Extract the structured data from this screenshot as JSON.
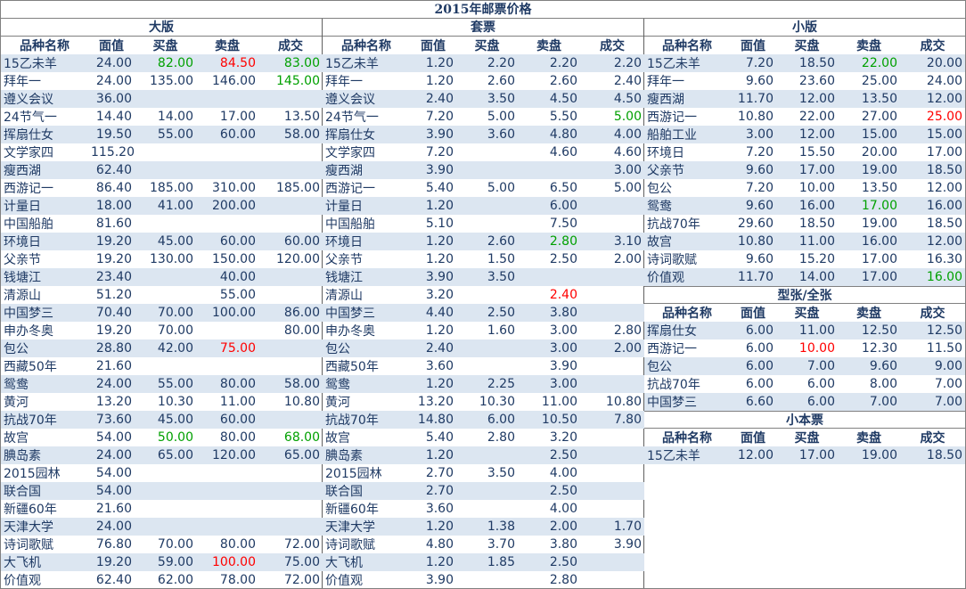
{
  "title": "2015年邮票价格",
  "headers": [
    "品种名称",
    "面值",
    "买盘",
    "卖盘",
    "成交"
  ],
  "colors": {
    "up": "#00a000",
    "down": "#ff0000",
    "stripe": "#dce6f1",
    "text": "#1f3a64"
  },
  "left": {
    "title": "大版",
    "rows": [
      {
        "name": "15乙未羊",
        "face": "24.00",
        "bid": "82.00",
        "ask": "84.50",
        "deal": "83.00",
        "bc": "green",
        "ac": "red",
        "dc": "green"
      },
      {
        "name": "拜年一",
        "face": "24.00",
        "bid": "135.00",
        "ask": "146.00",
        "deal": "145.00",
        "dc": "green"
      },
      {
        "name": "遵义会议",
        "face": "36.00",
        "bid": "",
        "ask": "",
        "deal": ""
      },
      {
        "name": "24节气一",
        "face": "14.40",
        "bid": "14.00",
        "ask": "17.00",
        "deal": "13.50"
      },
      {
        "name": "挥扇仕女",
        "face": "19.50",
        "bid": "55.00",
        "ask": "60.00",
        "deal": "58.00"
      },
      {
        "name": "文学家四",
        "face": "115.20",
        "bid": "",
        "ask": "",
        "deal": ""
      },
      {
        "name": "瘦西湖",
        "face": "62.40",
        "bid": "",
        "ask": "",
        "deal": ""
      },
      {
        "name": "西游记一",
        "face": "86.40",
        "bid": "185.00",
        "ask": "310.00",
        "deal": "185.00"
      },
      {
        "name": "计量日",
        "face": "18.00",
        "bid": "41.00",
        "ask": "200.00",
        "deal": ""
      },
      {
        "name": "中国船舶",
        "face": "81.60",
        "bid": "",
        "ask": "",
        "deal": ""
      },
      {
        "name": "环境日",
        "face": "19.20",
        "bid": "45.00",
        "ask": "60.00",
        "deal": "60.00"
      },
      {
        "name": "父亲节",
        "face": "19.20",
        "bid": "130.00",
        "ask": "150.00",
        "deal": "120.00"
      },
      {
        "name": "钱塘江",
        "face": "23.40",
        "bid": "",
        "ask": "40.00",
        "deal": ""
      },
      {
        "name": "清源山",
        "face": "51.20",
        "bid": "",
        "ask": "55.00",
        "deal": ""
      },
      {
        "name": "中国梦三",
        "face": "70.40",
        "bid": "70.00",
        "ask": "100.00",
        "deal": "86.00"
      },
      {
        "name": "申办冬奥",
        "face": "19.20",
        "bid": "70.00",
        "ask": "",
        "deal": "80.00"
      },
      {
        "name": "包公",
        "face": "28.80",
        "bid": "42.00",
        "ask": "75.00",
        "deal": "",
        "ac": "red"
      },
      {
        "name": "西藏50年",
        "face": "21.60",
        "bid": "",
        "ask": "",
        "deal": ""
      },
      {
        "name": "鸳鸯",
        "face": "24.00",
        "bid": "55.00",
        "ask": "80.00",
        "deal": "58.00"
      },
      {
        "name": "黄河",
        "face": "13.20",
        "bid": "10.30",
        "ask": "11.00",
        "deal": "10.80"
      },
      {
        "name": "抗战70年",
        "face": "73.60",
        "bid": "45.00",
        "ask": "60.00",
        "deal": ""
      },
      {
        "name": "故宫",
        "face": "54.00",
        "bid": "50.00",
        "ask": "80.00",
        "deal": "68.00",
        "bc": "green",
        "dc": "green"
      },
      {
        "name": "腆岛素",
        "face": "24.00",
        "bid": "65.00",
        "ask": "120.00",
        "deal": "65.00"
      },
      {
        "name": "2015园林",
        "face": "54.00",
        "bid": "",
        "ask": "",
        "deal": ""
      },
      {
        "name": "联合国",
        "face": "54.00",
        "bid": "",
        "ask": "",
        "deal": ""
      },
      {
        "name": "新疆60年",
        "face": "21.60",
        "bid": "",
        "ask": "",
        "deal": ""
      },
      {
        "name": "天津大学",
        "face": "24.00",
        "bid": "",
        "ask": "",
        "deal": ""
      },
      {
        "name": "诗词歌赋",
        "face": "76.80",
        "bid": "70.00",
        "ask": "80.00",
        "deal": "72.00"
      },
      {
        "name": "大飞机",
        "face": "19.20",
        "bid": "59.00",
        "ask": "100.00",
        "deal": "75.00",
        "ac": "red"
      },
      {
        "name": "价值观",
        "face": "62.40",
        "bid": "62.00",
        "ask": "78.00",
        "deal": "72.00"
      }
    ]
  },
  "mid": {
    "title": "套票",
    "rows": [
      {
        "name": "15乙未羊",
        "face": "1.20",
        "bid": "2.20",
        "ask": "2.20",
        "deal": "2.20"
      },
      {
        "name": "拜年一",
        "face": "1.20",
        "bid": "2.60",
        "ask": "2.60",
        "deal": "2.40"
      },
      {
        "name": "遵义会议",
        "face": "2.40",
        "bid": "3.50",
        "ask": "4.50",
        "deal": "4.50"
      },
      {
        "name": "24节气一",
        "face": "7.20",
        "bid": "5.00",
        "ask": "5.50",
        "deal": "5.00",
        "dc": "green"
      },
      {
        "name": "挥扇仕女",
        "face": "3.90",
        "bid": "3.60",
        "ask": "4.80",
        "deal": "4.00"
      },
      {
        "name": "文学家四",
        "face": "7.20",
        "bid": "",
        "ask": "4.60",
        "deal": "4.60"
      },
      {
        "name": "瘦西湖",
        "face": "3.90",
        "bid": "",
        "ask": "",
        "deal": "3.00"
      },
      {
        "name": "西游记一",
        "face": "5.40",
        "bid": "5.00",
        "ask": "6.50",
        "deal": "5.00"
      },
      {
        "name": "计量日",
        "face": "1.20",
        "bid": "",
        "ask": "6.00",
        "deal": ""
      },
      {
        "name": "中国船舶",
        "face": "5.10",
        "bid": "",
        "ask": "7.50",
        "deal": ""
      },
      {
        "name": "环境日",
        "face": "1.20",
        "bid": "2.60",
        "ask": "2.80",
        "deal": "3.10",
        "ac": "green"
      },
      {
        "name": "父亲节",
        "face": "1.20",
        "bid": "1.50",
        "ask": "2.50",
        "deal": "2.00"
      },
      {
        "name": "钱塘江",
        "face": "3.90",
        "bid": "3.50",
        "ask": "",
        "deal": ""
      },
      {
        "name": "清源山",
        "face": "3.20",
        "bid": "",
        "ask": "2.40",
        "deal": "",
        "ac": "red"
      },
      {
        "name": "中国梦三",
        "face": "4.40",
        "bid": "2.50",
        "ask": "3.80",
        "deal": ""
      },
      {
        "name": "申办冬奥",
        "face": "1.20",
        "bid": "1.60",
        "ask": "3.00",
        "deal": "2.80"
      },
      {
        "name": "包公",
        "face": "2.40",
        "bid": "",
        "ask": "3.00",
        "deal": "2.00"
      },
      {
        "name": "西藏50年",
        "face": "3.60",
        "bid": "",
        "ask": "3.90",
        "deal": ""
      },
      {
        "name": "鸳鸯",
        "face": "1.20",
        "bid": "2.25",
        "ask": "3.00",
        "deal": ""
      },
      {
        "name": "黄河",
        "face": "13.20",
        "bid": "10.30",
        "ask": "11.00",
        "deal": "10.80"
      },
      {
        "name": "抗战70年",
        "face": "14.80",
        "bid": "6.00",
        "ask": "10.50",
        "deal": "7.80"
      },
      {
        "name": "故宫",
        "face": "5.40",
        "bid": "2.80",
        "ask": "3.20",
        "deal": ""
      },
      {
        "name": "腆岛素",
        "face": "1.20",
        "bid": "",
        "ask": "2.50",
        "deal": ""
      },
      {
        "name": "2015园林",
        "face": "2.70",
        "bid": "3.50",
        "ask": "4.00",
        "deal": ""
      },
      {
        "name": "联合国",
        "face": "2.70",
        "bid": "",
        "ask": "2.50",
        "deal": ""
      },
      {
        "name": "新疆60年",
        "face": "3.60",
        "bid": "",
        "ask": "4.00",
        "deal": ""
      },
      {
        "name": "天津大学",
        "face": "1.20",
        "bid": "1.38",
        "ask": "2.00",
        "deal": "1.70"
      },
      {
        "name": "诗词歌赋",
        "face": "4.80",
        "bid": "3.70",
        "ask": "3.80",
        "deal": "3.90"
      },
      {
        "name": "大飞机",
        "face": "1.20",
        "bid": "1.85",
        "ask": "2.50",
        "deal": ""
      },
      {
        "name": "价值观",
        "face": "3.90",
        "bid": "",
        "ask": "2.80",
        "deal": ""
      }
    ]
  },
  "right": {
    "small": {
      "title": "小版",
      "rows": [
        {
          "name": "15乙未羊",
          "face": "7.20",
          "bid": "18.50",
          "ask": "22.00",
          "deal": "20.00",
          "ac": "green"
        },
        {
          "name": "拜年一",
          "face": "9.60",
          "bid": "23.60",
          "ask": "25.00",
          "deal": "24.00"
        },
        {
          "name": "瘦西湖",
          "face": "11.70",
          "bid": "12.00",
          "ask": "13.50",
          "deal": "12.00"
        },
        {
          "name": "西游记一",
          "face": "10.80",
          "bid": "22.00",
          "ask": "27.00",
          "deal": "25.00",
          "dc": "red"
        },
        {
          "name": "船舶工业",
          "face": "3.00",
          "bid": "12.00",
          "ask": "15.00",
          "deal": "15.00"
        },
        {
          "name": "环境日",
          "face": "7.20",
          "bid": "15.50",
          "ask": "20.00",
          "deal": "17.00"
        },
        {
          "name": "父亲节",
          "face": "9.60",
          "bid": "17.00",
          "ask": "19.00",
          "deal": "18.50"
        },
        {
          "name": "包公",
          "face": "7.20",
          "bid": "10.00",
          "ask": "13.50",
          "deal": "12.00"
        },
        {
          "name": "鸳鸯",
          "face": "9.60",
          "bid": "16.00",
          "ask": "17.00",
          "deal": "16.00",
          "ac": "green"
        },
        {
          "name": "抗战70年",
          "face": "29.60",
          "bid": "18.50",
          "ask": "19.00",
          "deal": "18.50"
        },
        {
          "name": "故宫",
          "face": "10.80",
          "bid": "11.00",
          "ask": "16.00",
          "deal": "12.00"
        },
        {
          "name": "诗词歌赋",
          "face": "9.60",
          "bid": "15.20",
          "ask": "17.00",
          "deal": "16.30"
        },
        {
          "name": "价值观",
          "face": "11.70",
          "bid": "14.00",
          "ask": "17.00",
          "deal": "16.00",
          "dc": "green"
        }
      ]
    },
    "sheet": {
      "title": "型张/全张",
      "rows": [
        {
          "name": "挥扇仕女",
          "face": "6.00",
          "bid": "11.00",
          "ask": "12.50",
          "deal": "12.50"
        },
        {
          "name": "西游记一",
          "face": "6.00",
          "bid": "10.00",
          "ask": "12.30",
          "deal": "11.50",
          "bc": "red"
        },
        {
          "name": "包公",
          "face": "6.00",
          "bid": "7.00",
          "ask": "9.60",
          "deal": "9.00"
        },
        {
          "name": "抗战70年",
          "face": "6.00",
          "bid": "6.00",
          "ask": "8.00",
          "deal": "7.00"
        },
        {
          "name": "中国梦三",
          "face": "6.60",
          "bid": "6.00",
          "ask": "7.00",
          "deal": "7.00"
        }
      ]
    },
    "booklet": {
      "title": "小本票",
      "rows": [
        {
          "name": "15乙未羊",
          "face": "12.00",
          "bid": "17.00",
          "ask": "19.00",
          "deal": "18.50"
        }
      ]
    }
  }
}
